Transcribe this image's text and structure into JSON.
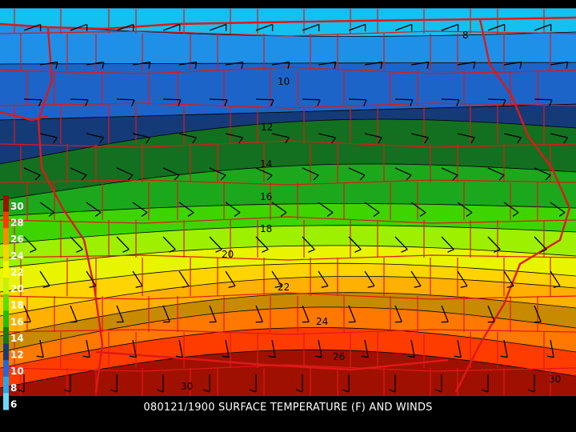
{
  "caption": "080121/1900 SURFACE TEMPERATURE (F) AND WINDS",
  "legend": {
    "values": [
      "30",
      "28",
      "26",
      "24",
      "22",
      "20",
      "18",
      "16",
      "14",
      "12",
      "10",
      "8",
      "6"
    ],
    "colors": [
      "#a01000",
      "#ff3a00",
      "#ff8a00",
      "#ffd000",
      "#f6f600",
      "#c8f000",
      "#5ae000",
      "#1ec000",
      "#127a20",
      "#163c78",
      "#1f6ad8",
      "#1eaaf0",
      "#6cd8f8"
    ]
  },
  "bands": [
    {
      "color": "#5ee8f0"
    },
    {
      "color": "#14c0f0"
    },
    {
      "color": "#1f90e8"
    },
    {
      "color": "#1c64c8"
    },
    {
      "color": "#153a78"
    },
    {
      "color": "#137020"
    },
    {
      "color": "#1ca81c"
    },
    {
      "color": "#3ed400"
    },
    {
      "color": "#9cf000"
    },
    {
      "color": "#e8f400"
    },
    {
      "color": "#ffd400"
    },
    {
      "color": "#ffb000"
    },
    {
      "color": "#c88a00"
    },
    {
      "color": "#ff7800"
    },
    {
      "color": "#ff3c00"
    },
    {
      "color": "#a01000"
    }
  ],
  "contour_labels": [
    "8",
    "10",
    "12",
    "14",
    "16",
    "18",
    "20",
    "22",
    "24",
    "26",
    "30",
    "30"
  ],
  "colors": {
    "county_border": "#e01818",
    "contour": "#000000",
    "barb": "#000000"
  }
}
